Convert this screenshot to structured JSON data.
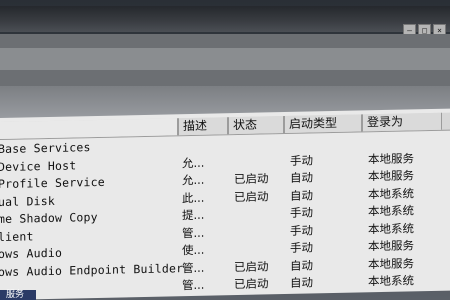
{
  "window": {
    "controls": [
      "minimize",
      "maximize",
      "close"
    ]
  },
  "table": {
    "headers": {
      "description": "描述",
      "status": "状态",
      "startup_type": "启动类型",
      "logon_as": "登录为"
    },
    "rows": [
      {
        "name": "Base Services",
        "description": "",
        "status": "",
        "startup_type": "",
        "logon_as": ""
      },
      {
        "name": " Device Host",
        "description": "允...",
        "status": "",
        "startup_type": "手动",
        "logon_as": "本地服务"
      },
      {
        "name": " Profile Service",
        "description": "允...",
        "status": "已启动",
        "startup_type": "自动",
        "logon_as": "本地服务"
      },
      {
        "name": "ual Disk",
        "description": "此...",
        "status": "已启动",
        "startup_type": "自动",
        "logon_as": "本地系统"
      },
      {
        "name": "me Shadow Copy",
        "description": "提...",
        "status": "",
        "startup_type": "手动",
        "logon_as": "本地系统"
      },
      {
        "name": "lient",
        "description": "管...",
        "status": "",
        "startup_type": "手动",
        "logon_as": "本地系统"
      },
      {
        "name": "ows Audio",
        "description": "使...",
        "status": "",
        "startup_type": "手动",
        "logon_as": "本地服务"
      },
      {
        "name": "ows Audio Endpoint Builder",
        "description": "管...",
        "status": "已启动",
        "startup_type": "自动",
        "logon_as": "本地服务"
      },
      {
        "name": "",
        "description": "管...",
        "status": "已启动",
        "startup_type": "自动",
        "logon_as": "本地系统"
      }
    ]
  },
  "bottom_tab": {
    "label": "服务"
  }
}
